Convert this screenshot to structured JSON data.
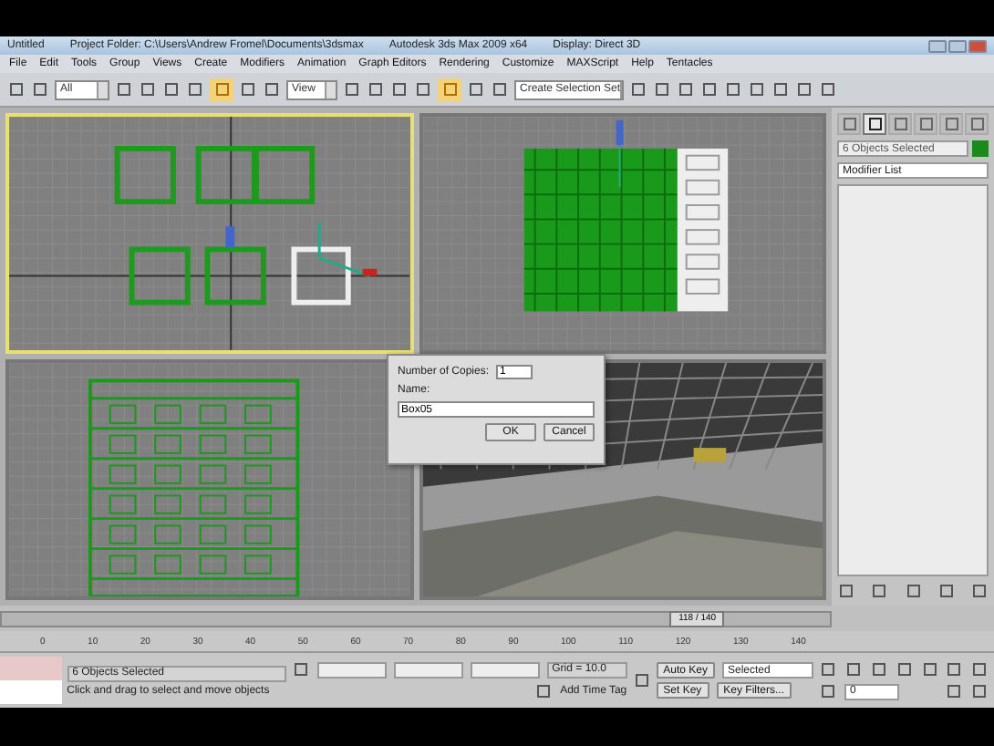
{
  "window": {
    "title": "Untitled",
    "project_folder": "Project Folder: C:\\Users\\Andrew Fromel\\Documents\\3dsmax",
    "app": "Autodesk 3ds Max 2009 x64",
    "display": "Display: Direct 3D"
  },
  "menu": [
    "File",
    "Edit",
    "Tools",
    "Group",
    "Views",
    "Create",
    "Modifiers",
    "Animation",
    "Graph Editors",
    "Rendering",
    "Customize",
    "MAXScript",
    "Help",
    "Tentacles"
  ],
  "toolbar": {
    "selection_filter": "All",
    "reference_coord": "View",
    "selection_set": "Create Selection Set"
  },
  "viewports": [
    {
      "kind": "top",
      "selected": true
    },
    {
      "kind": "front",
      "selected": false
    },
    {
      "kind": "left",
      "selected": false
    },
    {
      "kind": "perspective",
      "selected": false
    }
  ],
  "dialog": {
    "copies_label": "Number of Copies:",
    "copies": "1",
    "name_label": "Name:",
    "name": "Box05",
    "ok": "OK",
    "cancel": "Cancel"
  },
  "command_panel": {
    "tabs": [
      {
        "selected": false
      },
      {
        "selected": true
      },
      {
        "selected": false
      },
      {
        "selected": false
      },
      {
        "selected": false
      },
      {
        "selected": false
      }
    ],
    "selection": "6 Objects Selected",
    "modifier_list": "Modifier List"
  },
  "timeline": {
    "frame": "118 / 140",
    "level": 0.84,
    "ticks": [
      "0",
      "10",
      "20",
      "30",
      "40",
      "50",
      "60",
      "70",
      "80",
      "90",
      "100",
      "110",
      "120",
      "130",
      "140"
    ]
  },
  "status": {
    "selection": "6 Objects Selected",
    "prompt": "Click and drag to select and move objects",
    "grid": "Grid = 10.0",
    "time_tag": "Add Time Tag",
    "auto_key": "Auto Key",
    "key_mode": "Selected",
    "set_key": "Set Key",
    "key_filters": "Key Filters...",
    "frame": "0"
  }
}
